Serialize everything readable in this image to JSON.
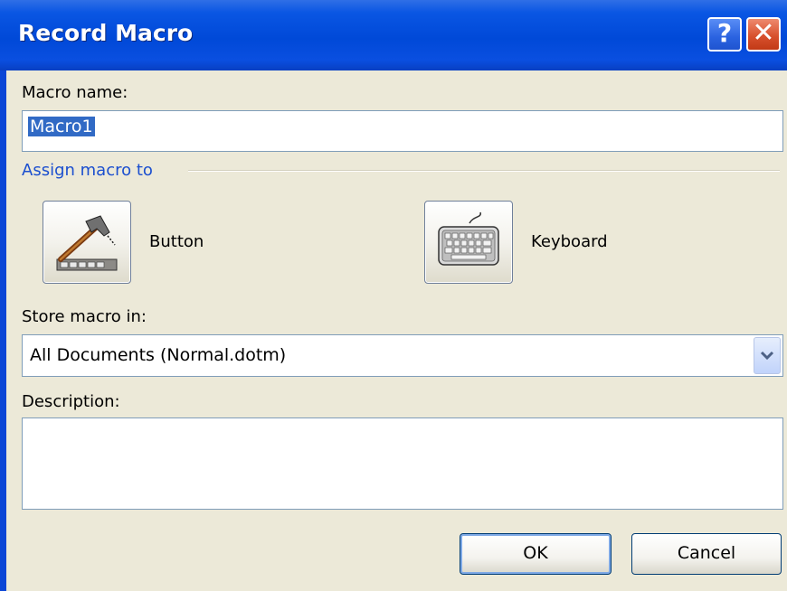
{
  "window": {
    "title": "Record Macro",
    "help_glyph": "?",
    "close_glyph": "✕"
  },
  "macro_name": {
    "label": "Macro name:",
    "value": "Macro1"
  },
  "assign": {
    "section_title": "Assign macro to",
    "button_label": "Button",
    "keyboard_label": "Keyboard"
  },
  "store": {
    "label": "Store macro in:",
    "selected": "All Documents (Normal.dotm)"
  },
  "description": {
    "label": "Description:",
    "value": ""
  },
  "actions": {
    "ok": "OK",
    "cancel": "Cancel"
  },
  "colors": {
    "titlebar": "#0a56e3",
    "section_title": "#1b4fcf",
    "dialog_bg": "#ece9d8",
    "selection": "#316ac5"
  }
}
